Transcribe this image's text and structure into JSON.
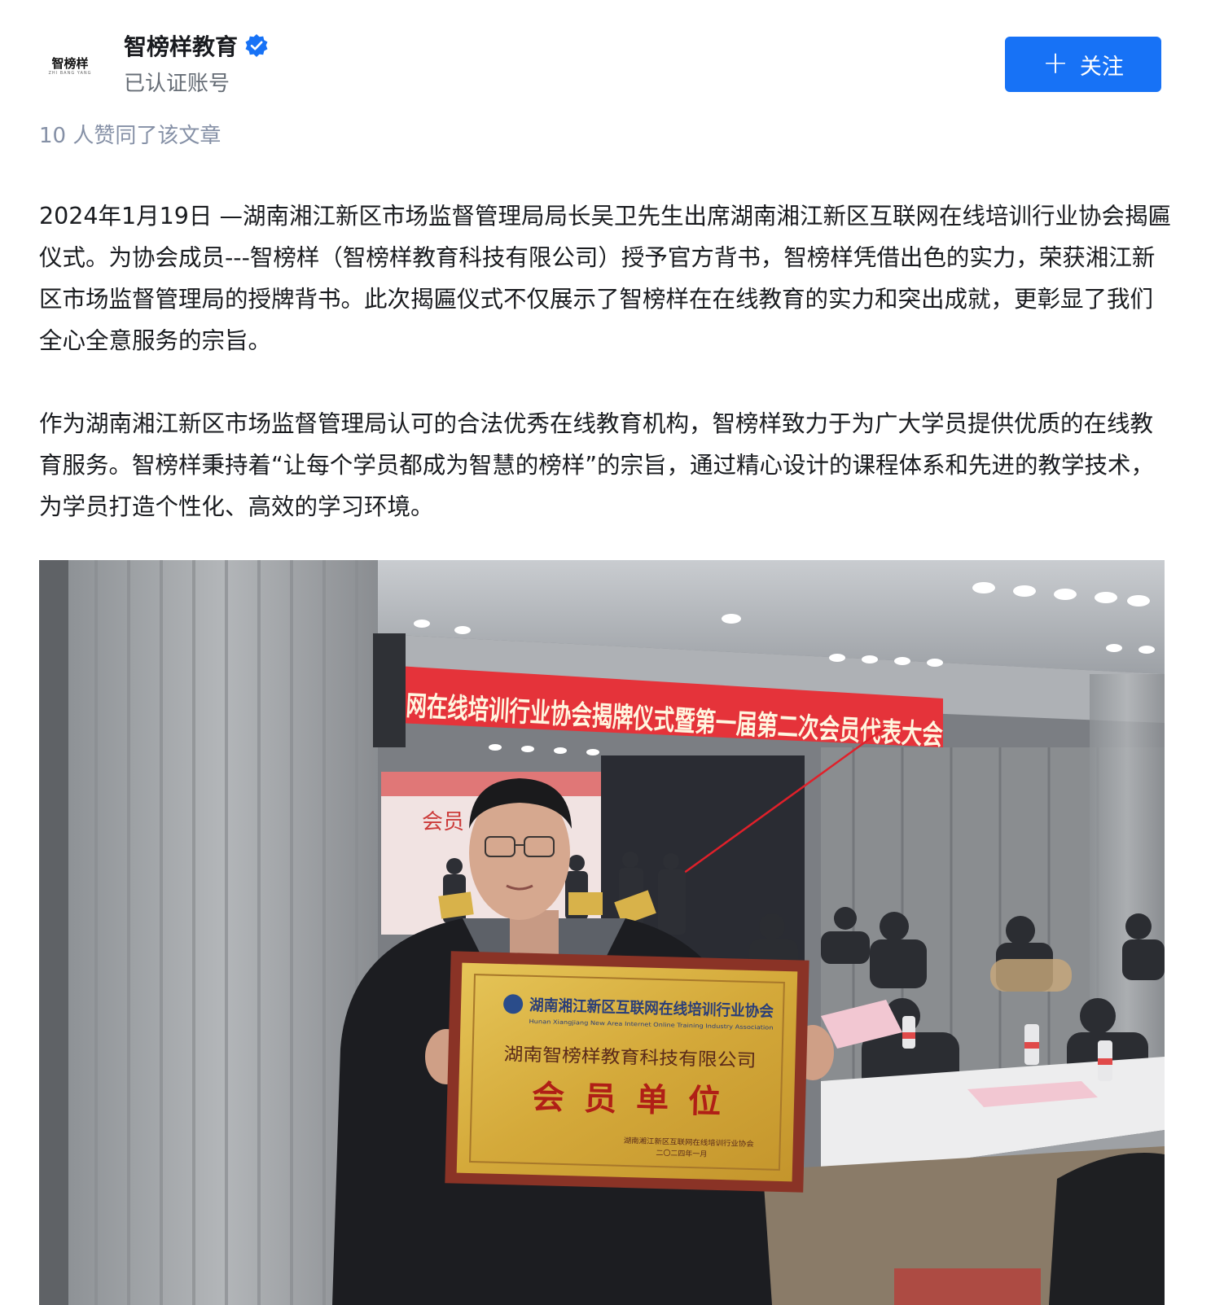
{
  "author": {
    "name": "智榜样教育",
    "description": "已认证账号",
    "avatar_text": "智榜样",
    "avatar_sub": "ZHI BANG YANG"
  },
  "follow_button": {
    "icon": "plus-icon",
    "label": "关注"
  },
  "likes": {
    "text": "10 人赞同了该文章"
  },
  "article": {
    "paragraphs": [
      "2024年1月19日 —湖南湘江新区市场监督管理局局长吴卫先生出席湖南湘江新区互联网在线培训行业协会揭匾仪式。为协会成员---智榜样（智榜样教育科技有限公司）授予官方背书，智榜样凭借出色的实力，荣获湘江新区市场监督管理局的授牌背书。此次揭匾仪式不仅展示了智榜样在在线教育的实力和突出成就，更彰显了我们全心全意服务的宗旨。",
      "作为湖南湘江新区市场监督管理局认可的合法优秀在线教育机构，智榜样致力于为广大学员提供优质的在线教育服务。智榜样秉持着“让每个学员都成为智慧的榜样”的宗旨，通过精心设计的课程体系和先进的教学技术，为学员打造个性化、高效的学习环境。"
    ]
  },
  "photo": {
    "banner_text": "网在线培训行业协会揭牌仪式暨第一届第二次会员代表大会",
    "plaque_header": "湖南湘江新区互联网在线培训行业协会",
    "plaque_header_en": "Hunan Xiangjiang New Area Internet Online Training Industry Association",
    "plaque_company": "湖南智榜样教育科技有限公司",
    "plaque_title": "会员单位",
    "plaque_footer": "湖南湘江新区互联网在线培训行业协会",
    "plaque_date": "二〇二四年一月",
    "screen_text": "会员"
  },
  "colors": {
    "accent": "#1772f6",
    "text": "#191b1f",
    "muted": "#8590a6",
    "banner_red": "#e5333a",
    "plaque_gold": "#d9b13c"
  }
}
